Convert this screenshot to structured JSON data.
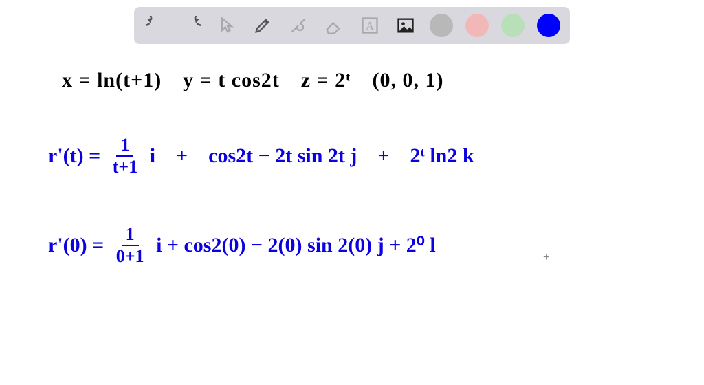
{
  "toolbar": {
    "tools": [
      {
        "name": "undo-icon"
      },
      {
        "name": "redo-icon"
      },
      {
        "name": "pointer-icon"
      },
      {
        "name": "pencil-icon"
      },
      {
        "name": "tools-icon"
      },
      {
        "name": "eraser-icon"
      },
      {
        "name": "text-icon"
      },
      {
        "name": "image-icon"
      }
    ],
    "colors": [
      {
        "name": "gray",
        "hex": "#b8b8b8"
      },
      {
        "name": "pink",
        "hex": "#f2b8b8"
      },
      {
        "name": "green",
        "hex": "#b8e0b8"
      },
      {
        "name": "blue",
        "hex": "#0000ff"
      }
    ]
  },
  "handwriting": {
    "line1_black": "x = ln(t+1) y = t cos2t z = 2ᵗ (0, 0, 1)",
    "line2_prefix": "r'(t) = ",
    "line2_frac_num": "1",
    "line2_frac_den": "t+1",
    "line2_rest": " i + cos2t − 2t sin 2t  j + 2ᵗ ln2  k",
    "line3_prefix": "r'(0) = ",
    "line3_frac_num": "1",
    "line3_frac_den": "0+1",
    "line3_rest": " i  +  cos2(0) − 2(0) sin 2(0)  j  +  2⁰ l"
  }
}
